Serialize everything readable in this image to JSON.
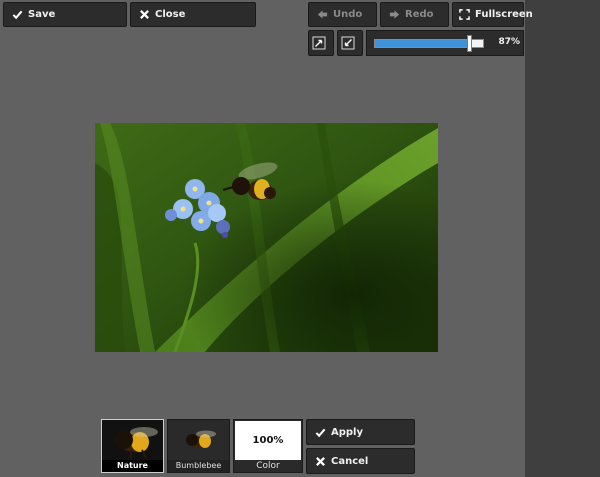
{
  "toolbar": {
    "save_label": "Save",
    "close_label": "Close",
    "undo_label": "Undo",
    "redo_label": "Redo",
    "fullscreen_label": "Fullscreen"
  },
  "zoom": {
    "value_percent": 87,
    "readout": "87%"
  },
  "filters": {
    "thumbnails": [
      {
        "label": "Nature",
        "selected": true
      },
      {
        "label": "Bumblebee",
        "selected": false
      }
    ],
    "color": {
      "value": "100%",
      "label": "Color"
    },
    "apply_label": "Apply",
    "cancel_label": "Cancel"
  },
  "icons": {
    "save": "check-icon",
    "close": "x-icon",
    "undo": "arrow-left-icon",
    "redo": "arrow-right-icon",
    "fullscreen": "fullscreen-icon",
    "fit": "fit-to-window-icon",
    "actual_size": "actual-size-icon"
  },
  "colors": {
    "workspace": "#616161",
    "slider_fill": "#3e93d8",
    "button_bg": "#2c2c2c"
  }
}
